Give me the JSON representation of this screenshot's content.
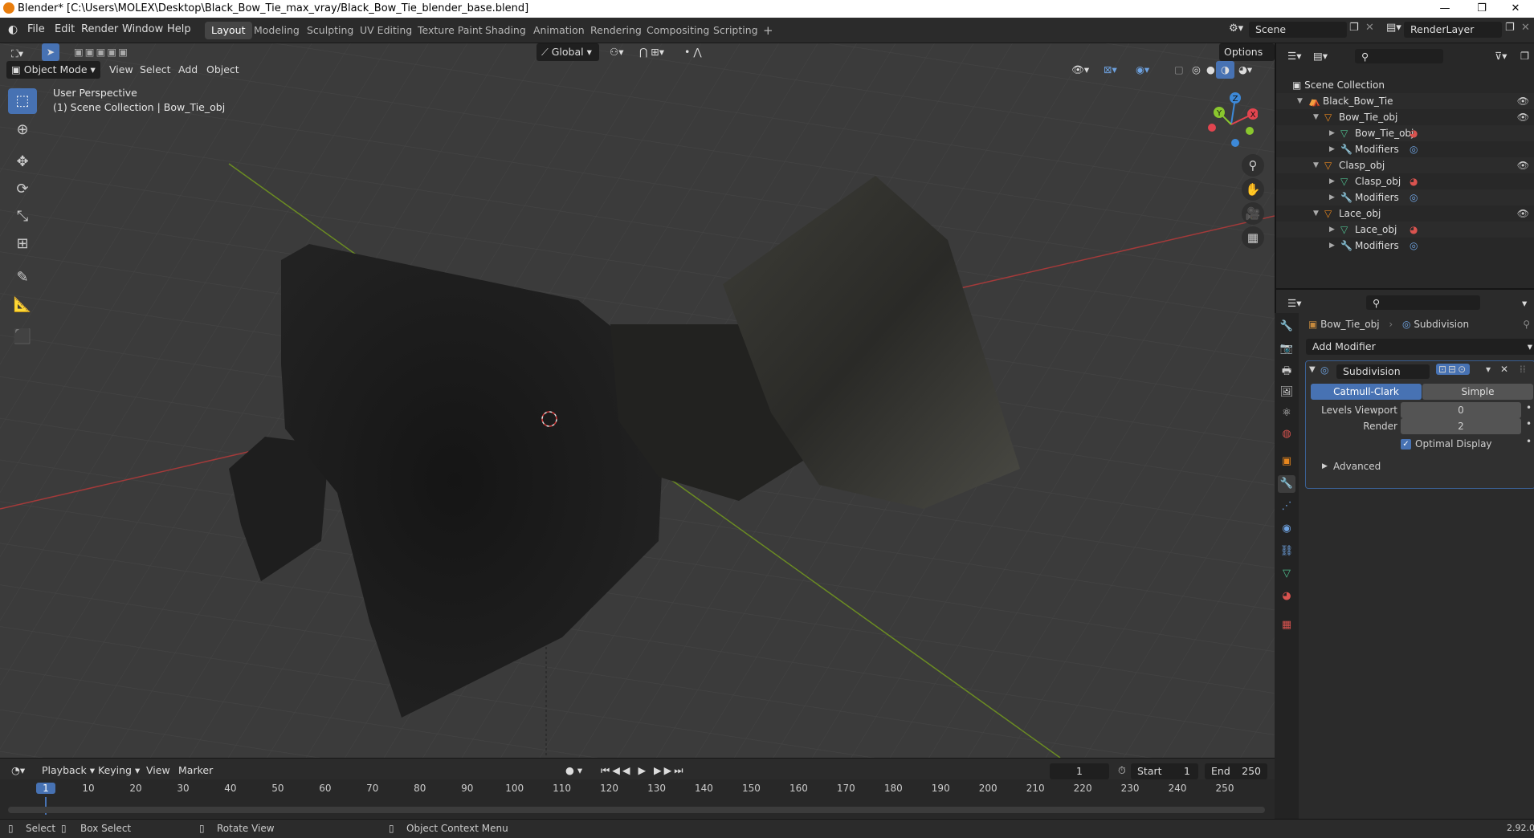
{
  "window": {
    "title": "Blender* [C:\\Users\\MOLEX\\Desktop\\Black_Bow_Tie_max_vray/Black_Bow_Tie_blender_base.blend]",
    "controls": [
      "—",
      "❐",
      "✕"
    ]
  },
  "topbar": {
    "menus": [
      "File",
      "Edit",
      "Render",
      "Window",
      "Help"
    ],
    "workspaces": [
      "Layout",
      "Modeling",
      "Sculpting",
      "UV Editing",
      "Texture Paint",
      "Shading",
      "Animation",
      "Rendering",
      "Compositing",
      "Scripting"
    ],
    "active_workspace": "Layout",
    "add_workspace": "+",
    "scene_name": "Scene",
    "render_layer": "RenderLayer"
  },
  "viewport_header": {
    "mode": "Object Mode",
    "menus": [
      "View",
      "Select",
      "Add",
      "Object"
    ],
    "orientation": "Global",
    "options": "Options"
  },
  "viewport": {
    "perspective": "User Perspective",
    "collection_info": "(1) Scene Collection | Bow_Tie_obj",
    "gizmo_axes": {
      "x": "X",
      "y": "Y",
      "z": "Z"
    },
    "colors": {
      "x": "#e2454f",
      "y": "#8ac72e",
      "z": "#3d89d8",
      "bg": "#3b3b3b"
    }
  },
  "outliner": {
    "root": "Scene Collection",
    "items": [
      {
        "label": "Black_Bow_Tie",
        "depth": 0
      },
      {
        "label": "Bow_Tie_obj",
        "depth": 1
      },
      {
        "label": "Bow_Tie_obj",
        "depth": 2
      },
      {
        "label": "Modifiers",
        "depth": 2
      },
      {
        "label": "Clasp_obj",
        "depth": 1
      },
      {
        "label": "Clasp_obj",
        "depth": 2
      },
      {
        "label": "Modifiers",
        "depth": 2
      },
      {
        "label": "Lace_obj",
        "depth": 1
      },
      {
        "label": "Lace_obj",
        "depth": 2
      },
      {
        "label": "Modifiers",
        "depth": 2
      }
    ]
  },
  "properties": {
    "breadcrumb_object": "Bow_Tie_obj",
    "breadcrumb_modifier": "Subdivision",
    "add_modifier": "Add Modifier",
    "modifier_name": "Subdivision",
    "type_options": [
      "Catmull-Clark",
      "Simple"
    ],
    "active_type": "Catmull-Clark",
    "levels_viewport_label": "Levels Viewport",
    "levels_viewport_value": "0",
    "render_label": "Render",
    "render_value": "2",
    "optimal_display_label": "Optimal Display",
    "optimal_display_checked": true,
    "advanced_label": "Advanced"
  },
  "timeline": {
    "menus": [
      "Playback",
      "Keying",
      "View",
      "Marker"
    ],
    "current_frame": "1",
    "start_label": "Start",
    "start_value": "1",
    "end_label": "End",
    "end_value": "250",
    "ticks": [
      "1",
      "10",
      "20",
      "30",
      "40",
      "50",
      "60",
      "70",
      "80",
      "90",
      "100",
      "110",
      "120",
      "130",
      "140",
      "150",
      "160",
      "170",
      "180",
      "190",
      "200",
      "210",
      "220",
      "230",
      "240",
      "250"
    ]
  },
  "statusbar": {
    "select": "Select",
    "box_select": "Box Select",
    "rotate_view": "Rotate View",
    "context_menu": "Object Context Menu",
    "version": "2.92.0"
  }
}
